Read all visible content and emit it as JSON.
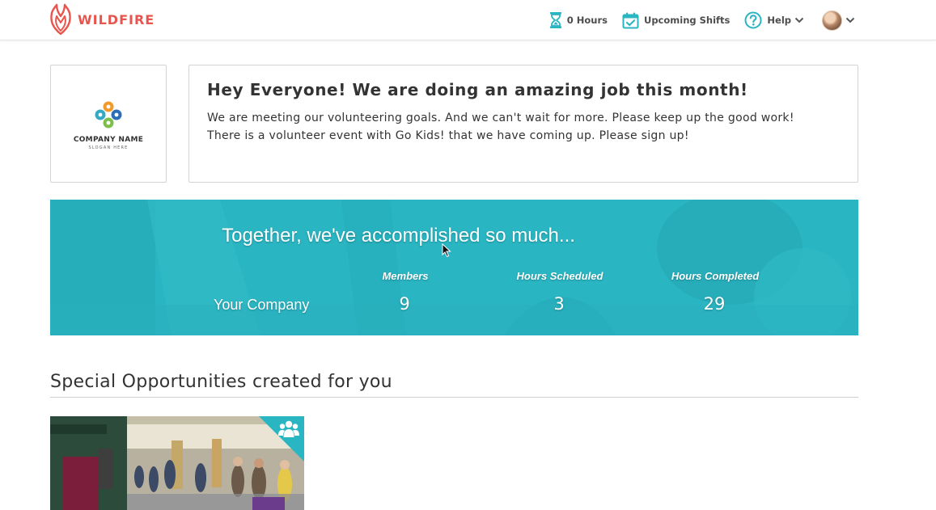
{
  "brand": {
    "name": "WILDFIRE",
    "color": "#e8554e"
  },
  "nav": {
    "hours_label": "0 Hours",
    "shifts_label": "Upcoming Shifts",
    "help_label": "Help",
    "accent": "#2ab5c2"
  },
  "company_logo": {
    "name": "COMPANY NAME",
    "slogan": "SLOGAN HERE"
  },
  "message": {
    "title": "Hey Everyone! We are doing an amazing job this month!",
    "line1": "We are meeting our volunteering goals. And we can't wait for more. Please keep up the good work!",
    "line2": "There is a volunteer event with Go Kids! that we have coming up. Please sign up!"
  },
  "banner": {
    "title": "Together, we've accomplished so much...",
    "row_label": "Your Company",
    "color": "#2ab5c2",
    "stats": [
      {
        "label": "Members",
        "value": "9"
      },
      {
        "label": "Hours Scheduled",
        "value": "3"
      },
      {
        "label": "Hours Completed",
        "value": "29"
      }
    ]
  },
  "opportunities": {
    "title": "Special Opportunities created for you",
    "cards": [
      {
        "icon": "group-icon"
      }
    ]
  }
}
